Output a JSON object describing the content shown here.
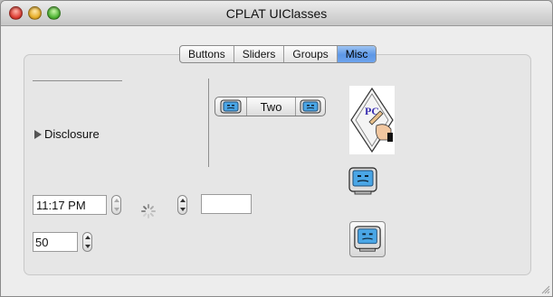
{
  "window": {
    "title": "CPLAT UIClasses"
  },
  "tabs": [
    {
      "label": "Buttons",
      "selected": false
    },
    {
      "label": "Sliders",
      "selected": false
    },
    {
      "label": "Groups",
      "selected": false
    },
    {
      "label": "Misc",
      "selected": true
    }
  ],
  "misc": {
    "disclosure_label": "Disclosure",
    "segmented": {
      "center_label": "Two",
      "left_icon": "mac-face-icon",
      "right_icon": "mac-face-icon"
    },
    "time_value": "11:17 PM",
    "number_value": "50",
    "empty_field_value": "",
    "image_label": "PC"
  },
  "colors": {
    "tab_selected": "#5c97e6",
    "window_bg": "#ececec"
  }
}
